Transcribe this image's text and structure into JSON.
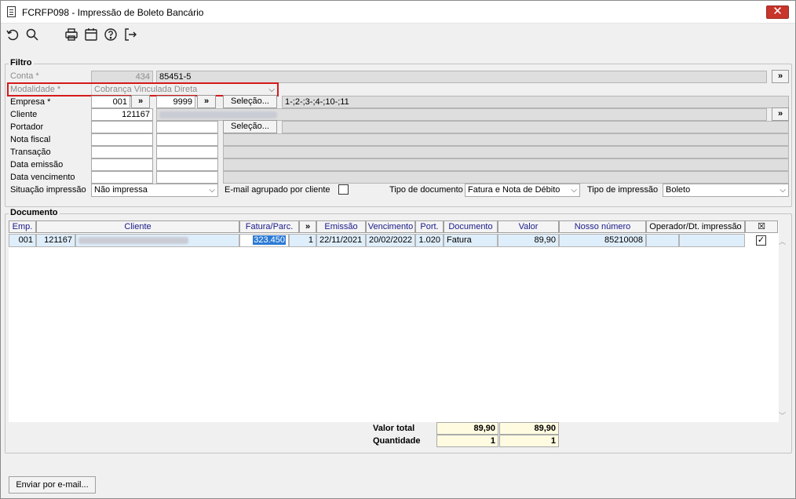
{
  "window": {
    "title": "FCRFP098 - Impressão de Boleto Bancário",
    "close": "✕"
  },
  "filtro": {
    "legend": "Filtro",
    "conta": {
      "label": "Conta *",
      "code": "434",
      "value": "85451-5"
    },
    "modalidade": {
      "label": "Modalidade *",
      "value": "Cobrança Vinculada Direta"
    },
    "empresa": {
      "label": "Empresa *",
      "from": "001",
      "to": "9999",
      "selecao": "Seleção...",
      "list": "1-;2-;3-;4-;10-;11"
    },
    "cliente": {
      "label": "Cliente",
      "code": "121167"
    },
    "portador": {
      "label": "Portador",
      "selecao": "Seleção..."
    },
    "nota_fiscal": {
      "label": "Nota fiscal"
    },
    "transacao": {
      "label": "Transação"
    },
    "data_emissao": {
      "label": "Data emissão"
    },
    "data_vencimento": {
      "label": "Data vencimento"
    },
    "situacao": {
      "label": "Situação impressão",
      "value": "Não impressa"
    },
    "email_agrupado": {
      "label": "E-mail agrupado por cliente",
      "checked": false
    },
    "tipo_documento": {
      "label": "Tipo de documento",
      "value": "Fatura e Nota de Débito"
    },
    "tipo_impressao": {
      "label": "Tipo de impressão",
      "value": "Boleto"
    },
    "arrow_button": "»"
  },
  "documento": {
    "legend": "Documento",
    "columns": [
      "Emp.",
      "Cliente",
      "Fatura/Parc.",
      "»",
      "Emissão",
      "Vencimento",
      "Port.",
      "Documento",
      "Valor",
      "Nosso número",
      "Operador/Dt. impressão"
    ],
    "rows": [
      {
        "emp": "001",
        "cliente_code": "121167",
        "fatura": "323.450",
        "parcela": "1",
        "emissao": "22/11/2021",
        "vencimento": "20/02/2022",
        "portador": "1.020",
        "documento": "Fatura",
        "valor": "89,90",
        "nosso_numero": "85210008",
        "checked": true
      }
    ]
  },
  "totals": {
    "valor_total_label": "Valor total",
    "quantidade_label": "Quantidade",
    "valor_total_1": "89,90",
    "valor_total_2": "89,90",
    "quantidade_1": "1",
    "quantidade_2": "1"
  },
  "footer": {
    "email_button": "Enviar por e-mail..."
  }
}
